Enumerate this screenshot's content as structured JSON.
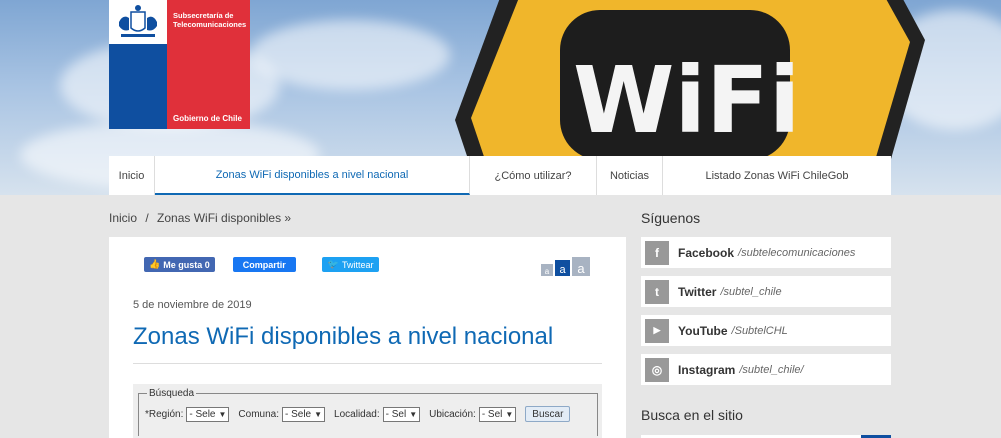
{
  "logo": {
    "subsecretaria": "Subsecretaría de Telecomunicaciones",
    "gobierno": "Gobierno de Chile"
  },
  "hero": {
    "sign_text": "WiFi"
  },
  "nav": {
    "items": [
      {
        "label": "Inicio"
      },
      {
        "label": "Zonas WiFi disponibles a nivel nacional"
      },
      {
        "label": "¿Cómo utilizar?"
      },
      {
        "label": "Noticias"
      },
      {
        "label": "Listado Zonas WiFi ChileGob"
      }
    ],
    "active_index": 1
  },
  "breadcrumb": {
    "home": "Inicio",
    "separator": "/",
    "current": "Zonas WiFi disponibles »"
  },
  "share": {
    "like": "Me gusta 0",
    "share": "Compartir",
    "tweet": "Twittear"
  },
  "font_size": {
    "small": "a",
    "medium": "a",
    "large": "a"
  },
  "article": {
    "date": "5 de noviembre de 2019",
    "title": "Zonas WiFi disponibles a nivel nacional"
  },
  "search_form": {
    "legend": "Búsqueda",
    "region_label": "*Región:",
    "region_value": "- Sele",
    "comuna_label": "Comuna:",
    "comuna_value": "- Sele",
    "localidad_label": "Localidad:",
    "localidad_value": "- Sel",
    "ubicacion_label": "Ubicación:",
    "ubicacion_value": "- Sel",
    "button": "Buscar"
  },
  "sidebar": {
    "follow_title": "Síguenos",
    "social": [
      {
        "name": "Facebook",
        "handle": "/subtelecomunicaciones",
        "icon": "f"
      },
      {
        "name": "Twitter",
        "handle": "/subtel_chile",
        "icon": "t"
      },
      {
        "name": "YouTube",
        "handle": "/SubtelCHL",
        "icon": "▶"
      },
      {
        "name": "Instagram",
        "handle": "/subtel_chile/",
        "icon": "◎"
      }
    ],
    "search_title": "Busca en el sitio"
  },
  "colors": {
    "gov_blue": "#0f4fa0",
    "gov_red": "#e0303a",
    "link_blue": "#0f69b4"
  }
}
